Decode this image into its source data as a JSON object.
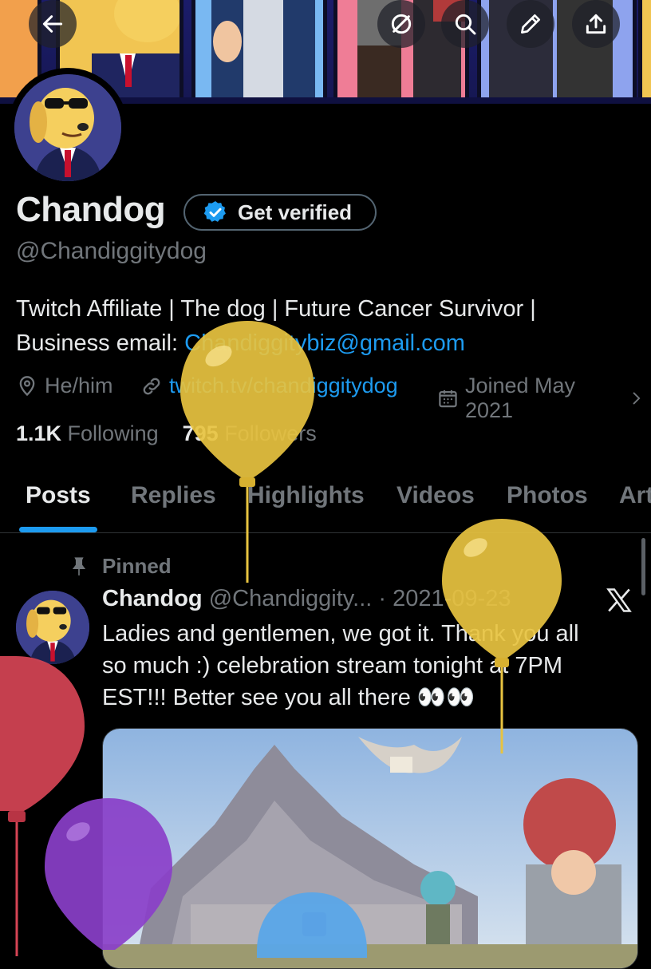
{
  "profile": {
    "name": "Chandog",
    "verify_label": "Get verified",
    "handle": "@Chandiggitydog",
    "bio_line1": "Twitch Affiliate | The dog | Future Cancer Survivor |",
    "bio_line2_prefix": "Business email: ",
    "bio_email": "Chandiggitybiz@gmail.com",
    "pronouns": "He/him",
    "website": "twitch.tv/chandiggitydog",
    "joined": "Joined May 2021",
    "following_count": "1.1K",
    "following_label": " Following",
    "followers_count": "795",
    "followers_label": " Followers"
  },
  "tabs": [
    "Posts",
    "Replies",
    "Highlights",
    "Videos",
    "Photos",
    "Art"
  ],
  "active_tab": "Posts",
  "pinned_post": {
    "pinned_label": "Pinned",
    "author_name": "Chandog",
    "author_handle": " @Chandiggity...",
    "sep": " · ",
    "date": "2021-09-23",
    "line1": "Ladies and gentlemen, we got it. Thank you all",
    "line2": "so much :) celebration stream tonight at 7PM",
    "line3": "EST!!! Better see you all there 👀👀"
  },
  "icons": {
    "back": "arrow-left-icon",
    "grok": "circle-slash-icon",
    "search": "search-icon",
    "edit": "pencil-icon",
    "share": "share-icon",
    "location": "location-pin-icon",
    "link": "link-icon",
    "calendar": "calendar-icon",
    "pin": "pin-icon",
    "x_logo": "x-logo-icon"
  },
  "colors": {
    "background": "#000000",
    "accent": "#1d9bf0",
    "text_primary": "#e7e9ea",
    "text_secondary": "#71767b",
    "balloon_yellow": "#e8c340",
    "balloon_red": "#d64455",
    "balloon_purple": "#8a3fc9",
    "balloon_blue": "#5aa6e8"
  }
}
